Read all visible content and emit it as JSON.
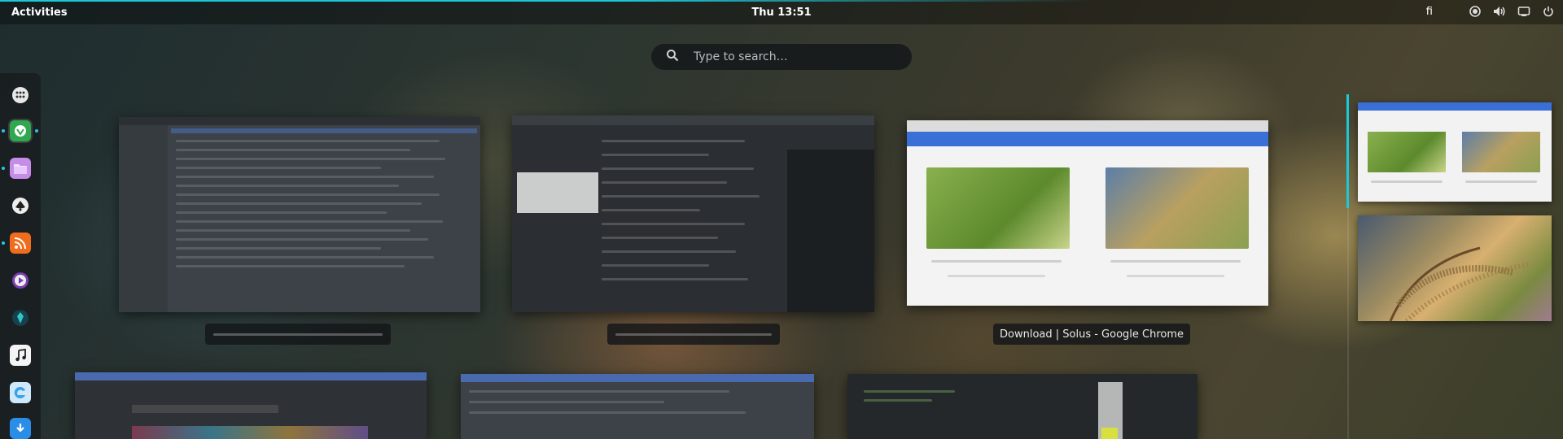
{
  "topbar": {
    "activities": "Activities",
    "clock": "Thu 13:51",
    "keyboard_layout": "fi"
  },
  "search": {
    "placeholder": "Type to search…"
  },
  "dash": {
    "items": [
      {
        "name": "show-apps-icon",
        "color": "#3a3f44",
        "running": false
      },
      {
        "name": "budgie-app-icon",
        "color": "#2fa84f",
        "running": true
      },
      {
        "name": "files-app-icon",
        "color": "#a86bd6",
        "running": true
      },
      {
        "name": "inkscape-app-icon",
        "color": "#3a3f44",
        "running": false
      },
      {
        "name": "rss-reader-app-icon",
        "color": "#f06d1e",
        "running": true
      },
      {
        "name": "media-player-app-icon",
        "color": "#7b3fb0",
        "running": false
      },
      {
        "name": "privacy-app-icon",
        "color": "#1a4a5a",
        "running": false
      },
      {
        "name": "music-app-icon",
        "color": "#e8e8e8",
        "running": false
      },
      {
        "name": "browser-app-icon",
        "color": "#3aa2e8",
        "running": false
      },
      {
        "name": "downloader-app-icon",
        "color": "#2a8de8",
        "running": false
      }
    ]
  },
  "windows": [
    {
      "caption": "",
      "label_style": "blurred"
    },
    {
      "caption": "",
      "label_style": "blurred"
    },
    {
      "caption": "Download | Solus - Google Chrome",
      "label_style": "clear"
    }
  ],
  "colors": {
    "accent": "#1cc8d8",
    "chrome_blue": "#3b6fd8"
  }
}
